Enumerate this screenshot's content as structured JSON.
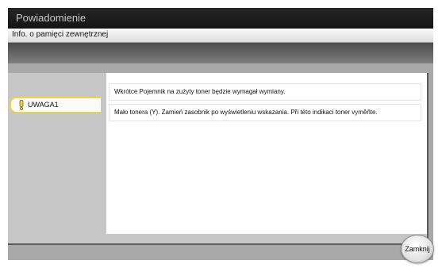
{
  "window": {
    "title": "Powiadomienie"
  },
  "header": {
    "subtitle": "Info. o pamięci zewnętrznej"
  },
  "notification": {
    "tab_label": "UWAGA1",
    "messages": [
      "Wkrótce Pojemnik na zużyty toner będzie wymagał wymiany.",
      "Mało tonera (Y). Zamień zasobnik po wyświetleniu wskazania. Při této indikaci toner vyměňte."
    ]
  },
  "footer": {
    "close_label": "Zamknij"
  },
  "colors": {
    "warning_accent": "#f0d248",
    "title_bar": "#1c1c1c"
  },
  "icons": {
    "warning": "warning-icon"
  }
}
